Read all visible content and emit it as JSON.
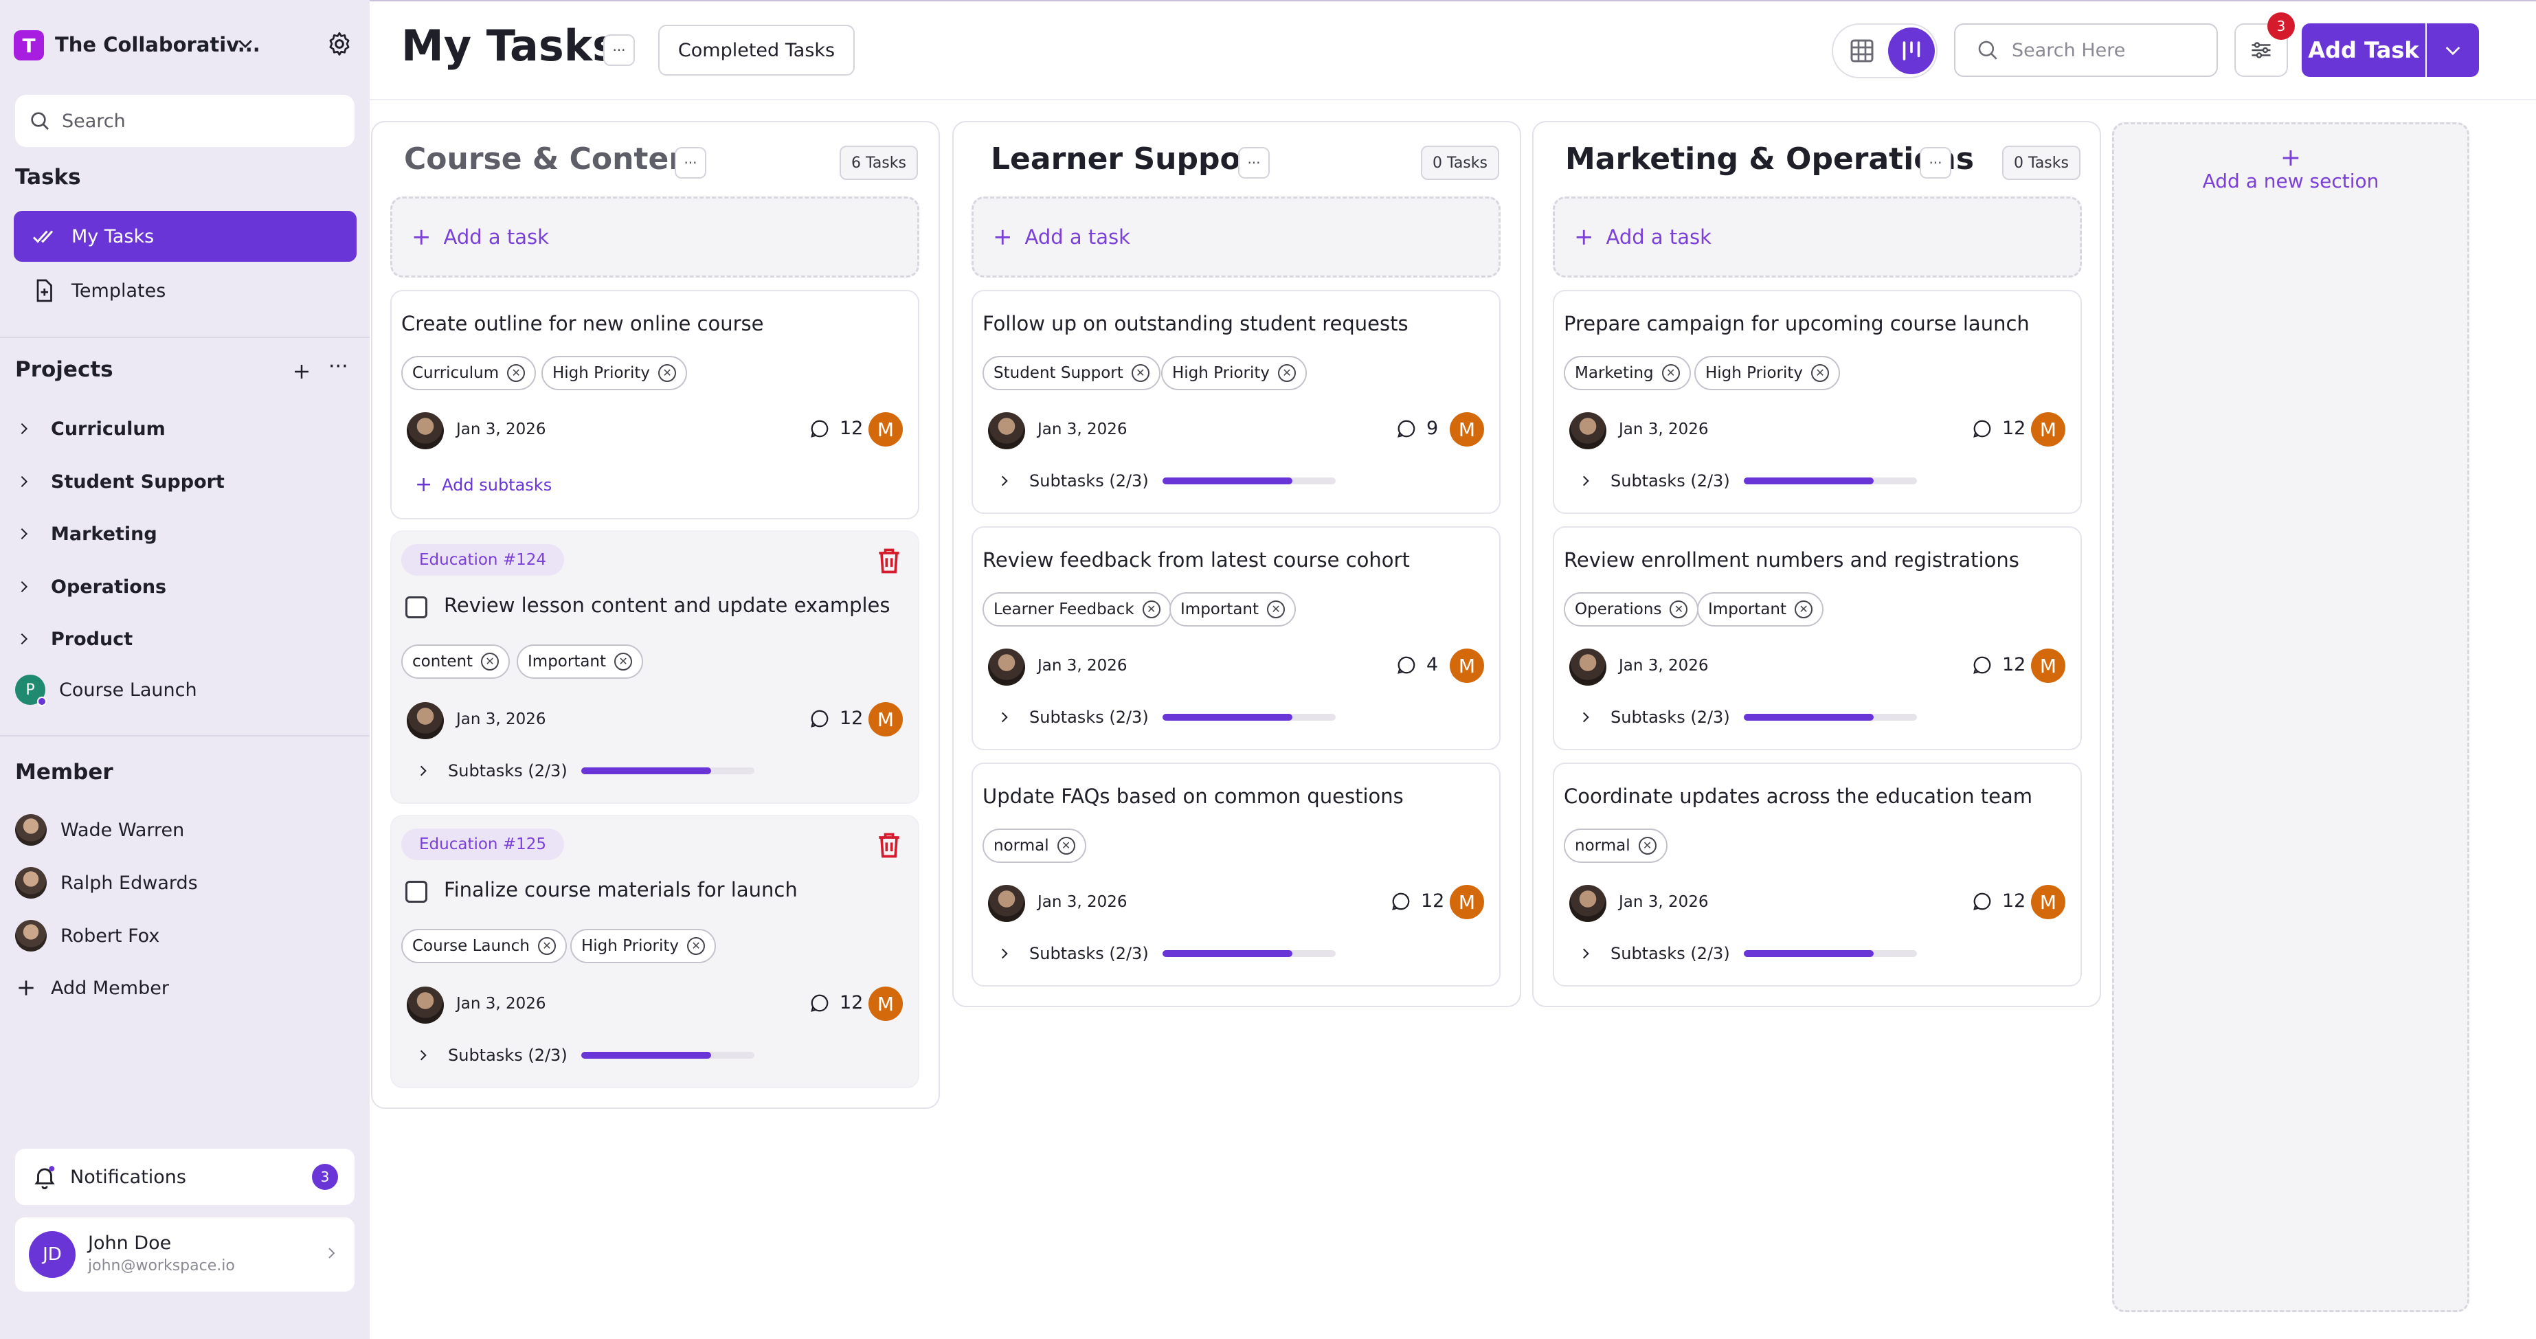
{
  "sidebar": {
    "workspace_initial": "T",
    "workspace_name": "The Collaborativ...",
    "search_placeholder": "Search",
    "tasks_heading": "Tasks",
    "tasks_items": [
      {
        "label": "My Tasks",
        "icon": "double-check-icon",
        "active": true
      },
      {
        "label": "Templates",
        "icon": "file-plus-icon",
        "active": false
      }
    ],
    "projects_heading": "Projects",
    "projects": [
      {
        "label": "Curriculum"
      },
      {
        "label": "Student Support"
      },
      {
        "label": "Marketing"
      },
      {
        "label": "Operations"
      },
      {
        "label": "Product"
      }
    ],
    "course_launch": {
      "initial": "P",
      "label": "Course Launch"
    },
    "member_heading": "Member",
    "members": [
      {
        "name": "Wade Warren"
      },
      {
        "name": "Ralph Edwards"
      },
      {
        "name": "Robert Fox"
      }
    ],
    "add_member_label": "Add Member",
    "notifications": {
      "label": "Notifications",
      "count": "3"
    },
    "user": {
      "initials": "JD",
      "name": "John Doe",
      "email": "john@workspace.io"
    }
  },
  "header": {
    "title": "My Tasks",
    "dots": "···",
    "completed_tasks_label": "Completed Tasks",
    "search_placeholder": "Search Here",
    "filter_badge": "3",
    "add_task_label": "Add Task"
  },
  "board": {
    "add_task_label": "Add a task",
    "add_section_label": "Add a new section",
    "columns": [
      {
        "title": "Course & Content",
        "count": "6 Tasks",
        "cards": [
          {
            "title": "Create outline for new online course",
            "tags": [
              "Curriculum",
              "High Priority"
            ],
            "date": "Jan 3, 2026",
            "comments": "12",
            "assignee": "M",
            "add_subtasks": "Add subtasks"
          },
          {
            "badge": "Education #124",
            "title": "Review lesson content and update examples",
            "tags": [
              "content",
              "Important"
            ],
            "date": "Jan 3, 2026",
            "comments": "12",
            "assignee": "M",
            "subtasks": "Subtasks (2/3)",
            "progress": 0.75
          },
          {
            "badge": "Education #125",
            "title": "Finalize course materials for launch",
            "tags": [
              "Course Launch",
              "High Priority"
            ],
            "date": "Jan 3, 2026",
            "comments": "12",
            "assignee": "M",
            "subtasks": "Subtasks (2/3)",
            "progress": 0.75
          }
        ]
      },
      {
        "title": "Learner Support",
        "count": "0 Tasks",
        "cards": [
          {
            "title": "Follow up on outstanding student requests",
            "tags": [
              "Student Support",
              "High Priority"
            ],
            "date": "Jan 3, 2026",
            "comments": "9",
            "assignee": "M",
            "subtasks": "Subtasks (2/3)",
            "progress": 0.75
          },
          {
            "title": "Review feedback from latest course cohort",
            "tags": [
              "Learner Feedback",
              "Important"
            ],
            "date": "Jan 3, 2026",
            "comments": "4",
            "assignee": "M",
            "subtasks": "Subtasks (2/3)",
            "progress": 0.75
          },
          {
            "title": "Update FAQs based on common questions",
            "tags": [
              "normal"
            ],
            "date": "Jan 3, 2026",
            "comments": "12",
            "assignee": "M",
            "subtasks": "Subtasks (2/3)",
            "progress": 0.75
          }
        ]
      },
      {
        "title": "Marketing & Operations",
        "count": "0 Tasks",
        "cards": [
          {
            "title": "Prepare campaign for upcoming course launch",
            "tags": [
              "Marketing",
              "High Priority"
            ],
            "date": "Jan 3, 2026",
            "comments": "12",
            "assignee": "M",
            "subtasks": "Subtasks (2/3)",
            "progress": 0.75
          },
          {
            "title": "Review enrollment numbers and registrations",
            "tags": [
              "Operations",
              "Important"
            ],
            "date": "Jan 3, 2026",
            "comments": "12",
            "assignee": "M",
            "subtasks": "Subtasks (2/3)",
            "progress": 0.75
          },
          {
            "title": "Coordinate updates across the education team",
            "tags": [
              "normal"
            ],
            "date": "Jan 3, 2026",
            "comments": "12",
            "assignee": "M",
            "subtasks": "Subtasks (2/3)",
            "progress": 0.75
          }
        ]
      }
    ]
  },
  "colors": {
    "accent": "#6a35d6",
    "workspace": "#a81ee0",
    "assignee": "#d4690c",
    "badge_red": "#d51b2b",
    "sidebar_bg": "#ece8f4"
  }
}
